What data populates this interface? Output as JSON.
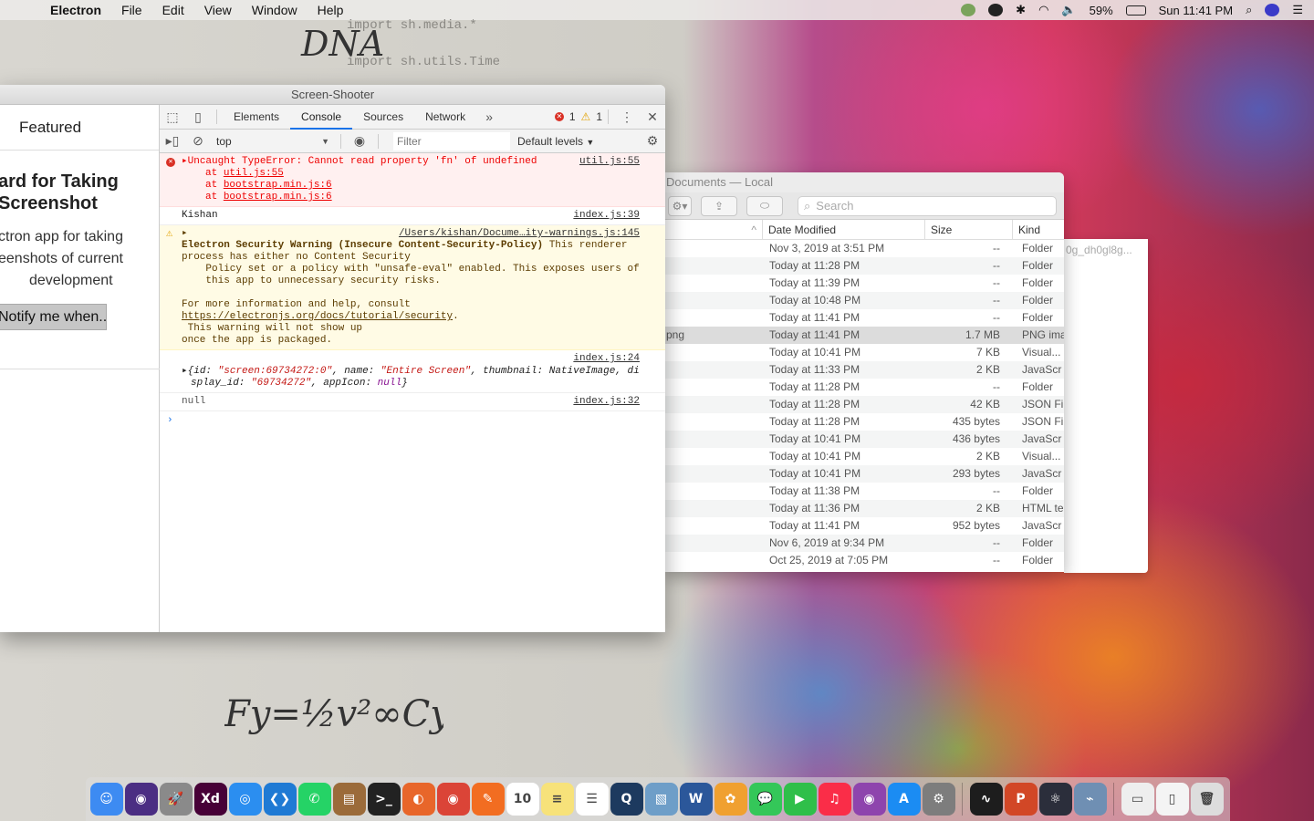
{
  "menubar": {
    "app_name": "Electron",
    "items": [
      "File",
      "Edit",
      "View",
      "Window",
      "Help"
    ],
    "battery": "59%",
    "clock": "Sun 11:41 PM"
  },
  "wallpaper": {
    "dna_label": "DNA",
    "code_lines": [
      "import sh.media.*",
      "import sh.utils.Time"
    ]
  },
  "electron_window": {
    "title": "Screen-Shooter",
    "featured_label": "Featured",
    "hero_title_line1": "ard for Taking",
    "hero_title_line2": "Screenshot",
    "hero_desc_line1": "ctron app for taking",
    "hero_desc_line2": "eenshots of current",
    "hero_desc_line3": "development",
    "notify_button": "Notify me when.."
  },
  "devtools": {
    "tabs": [
      "Elements",
      "Console",
      "Sources",
      "Network"
    ],
    "active_tab": "Console",
    "error_count": "1",
    "warning_count": "1",
    "context": "top",
    "filter_placeholder": "Filter",
    "levels": "Default levels",
    "messages": {
      "error": {
        "text": "Uncaught TypeError: Cannot read property 'fn' of undefined",
        "source": "util.js:55",
        "stack": [
          "util.js:55",
          "bootstrap.min.js:6",
          "bootstrap.min.js:6"
        ]
      },
      "log1": {
        "text": "Kishan",
        "source": "index.js:39"
      },
      "warning": {
        "source": "/Users/kishan/Docume…ity-warnings.js:145",
        "heading": "Electron Security Warning (Insecure Content-Security-Policy)",
        "line1_tail": "This renderer",
        "line2": "process has either no Content Security",
        "line3": "    Policy set or a policy with \"unsafe-eval\" enabled. This exposes users of",
        "line4": "    this app to unnecessary security risks.",
        "line5": "For more information and help, consult",
        "link": "https://electronjs.org/docs/tutorial/security",
        "line6": " This warning will not show up",
        "line7": "once the app is packaged."
      },
      "log2": {
        "source": "index.js:24",
        "id": "\"screen:69734272:0\"",
        "name": "\"Entire Screen\"",
        "thumbnail": "NativeImage",
        "display_id": "\"69734272\"",
        "appIcon": "null"
      },
      "log3": {
        "text": "null",
        "source": "index.js:32"
      }
    }
  },
  "finder": {
    "title": "Documents — Local",
    "search_placeholder": "Search",
    "columns": {
      "date": "Date Modified",
      "size": "Size",
      "kind": "Kind"
    },
    "behind_text": "0g_dh0gl8g...",
    "rows": [
      {
        "name": "",
        "date": "Nov 3, 2019 at 3:51 PM",
        "size": "--",
        "kind": "Folder"
      },
      {
        "name": "",
        "date": "Today at 11:28 PM",
        "size": "--",
        "kind": "Folder"
      },
      {
        "name": "",
        "date": "Today at 11:39 PM",
        "size": "--",
        "kind": "Folder"
      },
      {
        "name": "",
        "date": "Today at 10:48 PM",
        "size": "--",
        "kind": "Folder"
      },
      {
        "name": "",
        "date": "Today at 11:41 PM",
        "size": "--",
        "kind": "Folder"
      },
      {
        "name": "png",
        "date": "Today at 11:41 PM",
        "size": "1.7 MB",
        "kind": "PNG ima",
        "selected": true
      },
      {
        "name": "",
        "date": "Today at 10:41 PM",
        "size": "7 KB",
        "kind": "Visual..."
      },
      {
        "name": "",
        "date": "Today at 11:33 PM",
        "size": "2 KB",
        "kind": "JavaScr"
      },
      {
        "name": "",
        "date": "Today at 11:28 PM",
        "size": "--",
        "kind": "Folder"
      },
      {
        "name": "",
        "date": "Today at 11:28 PM",
        "size": "42 KB",
        "kind": "JSON Fi"
      },
      {
        "name": "",
        "date": "Today at 11:28 PM",
        "size": "435 bytes",
        "kind": "JSON Fi"
      },
      {
        "name": "",
        "date": "Today at 10:41 PM",
        "size": "436 bytes",
        "kind": "JavaScr"
      },
      {
        "name": "",
        "date": "Today at 10:41 PM",
        "size": "2 KB",
        "kind": "Visual..."
      },
      {
        "name": "",
        "date": "Today at 10:41 PM",
        "size": "293 bytes",
        "kind": "JavaScr"
      },
      {
        "name": "",
        "date": "Today at 11:38 PM",
        "size": "--",
        "kind": "Folder"
      },
      {
        "name": "",
        "date": "Today at 11:36 PM",
        "size": "2 KB",
        "kind": "HTML te"
      },
      {
        "name": "",
        "date": "Today at 11:41 PM",
        "size": "952 bytes",
        "kind": "JavaScr"
      },
      {
        "name": "",
        "date": "Nov 6, 2019 at 9:34 PM",
        "size": "--",
        "kind": "Folder"
      },
      {
        "name": "",
        "date": "Oct 25, 2019 at 7:05 PM",
        "size": "--",
        "kind": "Folder"
      }
    ]
  },
  "dock": {
    "apps": [
      {
        "name": "finder",
        "glyph": "☺",
        "color": "#3d8bf2"
      },
      {
        "name": "siri",
        "glyph": "◉",
        "color": "#4b2e83"
      },
      {
        "name": "launchpad",
        "glyph": "🚀",
        "color": "#8a8a8a"
      },
      {
        "name": "adobe-xd",
        "glyph": "Xd",
        "color": "#470137"
      },
      {
        "name": "safari",
        "glyph": "◎",
        "color": "#2b8ef0"
      },
      {
        "name": "vscode",
        "glyph": "❮❯",
        "color": "#1f7ad4"
      },
      {
        "name": "whatsapp",
        "glyph": "✆",
        "color": "#25d366"
      },
      {
        "name": "notebook",
        "glyph": "▤",
        "color": "#9b6b3a"
      },
      {
        "name": "terminal",
        "glyph": ">_",
        "color": "#222222"
      },
      {
        "name": "firefox",
        "glyph": "◐",
        "color": "#e8662a"
      },
      {
        "name": "chrome",
        "glyph": "◉",
        "color": "#db4437"
      },
      {
        "name": "sketch",
        "glyph": "✎",
        "color": "#f26d21"
      },
      {
        "name": "calendar",
        "glyph": "10",
        "color": "#ffffff"
      },
      {
        "name": "notes",
        "glyph": "≡",
        "color": "#f7e27a"
      },
      {
        "name": "reminders",
        "glyph": "☰",
        "color": "#ffffff"
      },
      {
        "name": "quicktime",
        "glyph": "Q",
        "color": "#1d3a5f"
      },
      {
        "name": "preview",
        "glyph": "▧",
        "color": "#6e9ec8"
      },
      {
        "name": "word",
        "glyph": "W",
        "color": "#2b579a"
      },
      {
        "name": "photos",
        "glyph": "✿",
        "color": "#f0a030"
      },
      {
        "name": "messages",
        "glyph": "💬",
        "color": "#34c759"
      },
      {
        "name": "facetime",
        "glyph": "▶",
        "color": "#2fbf4a"
      },
      {
        "name": "music",
        "glyph": "♫",
        "color": "#fa2d48"
      },
      {
        "name": "podcasts",
        "glyph": "◉",
        "color": "#8e44ad"
      },
      {
        "name": "app-store",
        "glyph": "A",
        "color": "#1b8cf3"
      },
      {
        "name": "system-preferences",
        "glyph": "⚙",
        "color": "#7d7d7d"
      },
      {
        "name": "activity-monitor",
        "glyph": "∿",
        "color": "#1d1d1d"
      },
      {
        "name": "powerpoint",
        "glyph": "P",
        "color": "#d24726"
      },
      {
        "name": "electron",
        "glyph": "⚛",
        "color": "#2b2e3b"
      },
      {
        "name": "network-utility",
        "glyph": "⌁",
        "color": "#6f8fb3"
      },
      {
        "name": "downloads-stack",
        "glyph": "▭",
        "color": "#eeeeee"
      },
      {
        "name": "documents-stack",
        "glyph": "▯",
        "color": "#f4f4f4"
      },
      {
        "name": "trash",
        "glyph": "🗑",
        "color": "#dddddd"
      }
    ]
  }
}
